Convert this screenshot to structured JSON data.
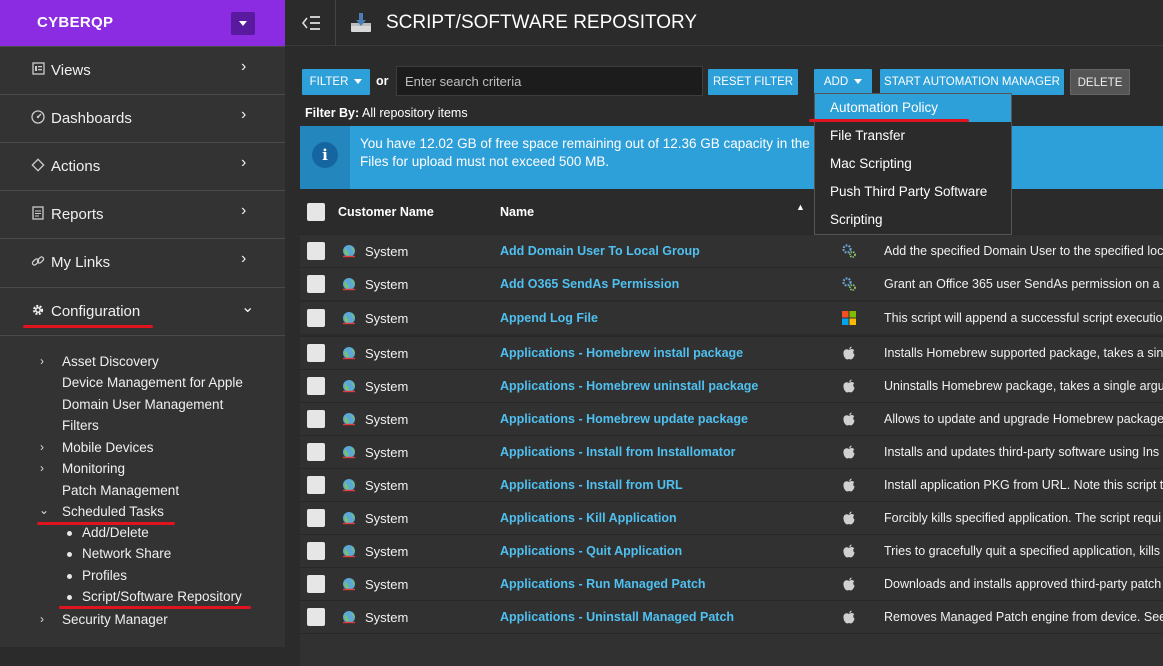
{
  "brand": {
    "name": "CYBERQP"
  },
  "nav": [
    {
      "label": "Views"
    },
    {
      "label": "Dashboards"
    },
    {
      "label": "Actions"
    },
    {
      "label": "Reports"
    },
    {
      "label": "My Links"
    },
    {
      "label": "Configuration"
    }
  ],
  "config_items": [
    "Asset Discovery",
    "Device Management for Apple",
    "Domain User Management",
    "Filters",
    "Mobile Devices",
    "Monitoring",
    "Patch Management",
    "Scheduled Tasks",
    "Security Manager"
  ],
  "scheduled_children": [
    "Add/Delete",
    "Network Share",
    "Profiles",
    "Script/Software Repository"
  ],
  "header": {
    "title": "SCRIPT/SOFTWARE REPOSITORY"
  },
  "toolbar": {
    "filter": "FILTER",
    "or": "or",
    "search_placeholder": "Enter search criteria",
    "reset": "RESET FILTER",
    "add": "ADD",
    "start": "START AUTOMATION MANAGER",
    "delete": "DELETE"
  },
  "filter_by": {
    "label": "Filter By:",
    "value": "All repository items"
  },
  "info": {
    "line1": "You have 12.02 GB of free space remaining out of 12.36 GB capacity in the r",
    "line2": "Files for upload must not exceed 500 MB."
  },
  "add_menu": [
    "Automation Policy",
    "File Transfer",
    "Mac Scripting",
    "Push Third Party Software",
    "Scripting"
  ],
  "table": {
    "headers": {
      "customer": "Customer Name",
      "name": "Name"
    },
    "rows": [
      {
        "customer": "System",
        "name": "Add Domain User To Local Group",
        "type": "gear",
        "desc": "Add the specified Domain User to the specified loc"
      },
      {
        "customer": "System",
        "name": "Add O365 SendAs Permission",
        "type": "gear",
        "desc": "Grant an Office 365 user SendAs permission on a m"
      },
      {
        "customer": "System",
        "name": "Append Log File",
        "type": "windows",
        "desc": "This script will append a successful script executio"
      },
      {
        "customer": "System",
        "name": "Applications - Homebrew install package",
        "type": "apple",
        "desc": "Installs Homebrew supported package, takes a sing"
      },
      {
        "customer": "System",
        "name": "Applications - Homebrew uninstall package",
        "type": "apple",
        "desc": "Uninstalls Homebrew package, takes a single argu"
      },
      {
        "customer": "System",
        "name": "Applications - Homebrew update package",
        "type": "apple",
        "desc": "Allows to update and upgrade Homebrew package"
      },
      {
        "customer": "System",
        "name": "Applications - Install from Installomator",
        "type": "apple",
        "desc": "Installs and updates third-party software using Ins"
      },
      {
        "customer": "System",
        "name": "Applications - Install from URL",
        "type": "apple",
        "desc": "Install application PKG from URL. Note this script t"
      },
      {
        "customer": "System",
        "name": "Applications - Kill Application",
        "type": "apple",
        "desc": "Forcibly kills specified application. The script requi"
      },
      {
        "customer": "System",
        "name": "Applications - Quit Application",
        "type": "apple",
        "desc": "Tries to gracefully quit a specified application, kills"
      },
      {
        "customer": "System",
        "name": "Applications - Run Managed Patch",
        "type": "apple",
        "desc": "Downloads and installs approved third-party patch"
      },
      {
        "customer": "System",
        "name": "Applications - Uninstall Managed Patch",
        "type": "apple",
        "desc": "Removes Managed Patch engine from device. See"
      }
    ]
  },
  "colors": {
    "brand": "#8b2be2",
    "accent": "#2d9fd9",
    "link": "#4fc0f0",
    "highlight": "#e0141e"
  }
}
